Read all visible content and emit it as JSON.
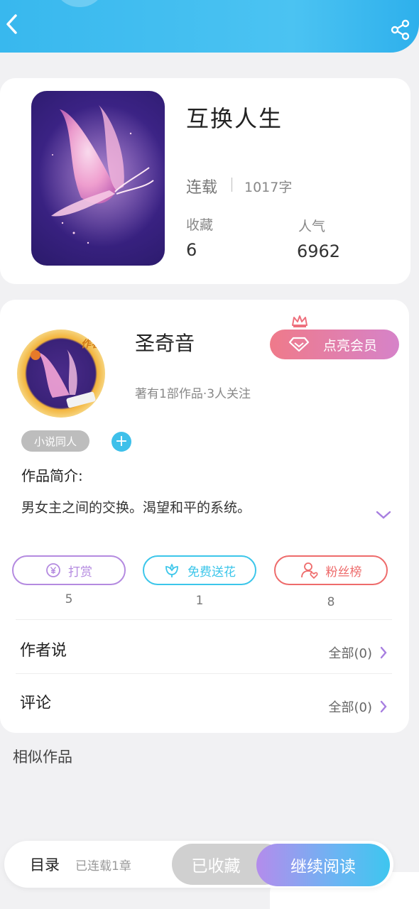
{
  "book": {
    "title": "互换人生",
    "status": "连载",
    "word_count": "1017字",
    "stats": [
      {
        "label": "收藏",
        "value": "6"
      },
      {
        "label": "人气",
        "value": "6962"
      }
    ]
  },
  "author": {
    "avatar_tag": "作者",
    "name": "圣奇音",
    "meta": "著有1部作品·3人关注",
    "vip_label": "点亮会员",
    "tag": "小说同人",
    "add_tag": "+"
  },
  "intro": {
    "title": "作品简介:",
    "text": "男女主之间的交换。渴望和平的系统。"
  },
  "actions": [
    {
      "label": "打赏",
      "count": "5",
      "color": "#b48ae0",
      "icon": "yen-coin-icon"
    },
    {
      "label": "免费送花",
      "count": "1",
      "color": "#3cc6ea",
      "icon": "flower-icon"
    },
    {
      "label": "粉丝榜",
      "count": "8",
      "color": "#ee6b6b",
      "icon": "fan-user-icon"
    }
  ],
  "rows": [
    {
      "title": "作者说",
      "right": "全部(0)"
    },
    {
      "title": "评论",
      "right": "全部(0)"
    }
  ],
  "similar_title": "相似作品",
  "bottom_bar": {
    "toc_label": "目录",
    "toc_sub": "已连载1章",
    "collected_label": "已收藏",
    "read_label": "继续阅读"
  },
  "colors": {
    "header": "#3fbdf0",
    "accent_purple": "#a77ee0",
    "accent_cyan": "#3ec6ef",
    "vip_pink": "#ef7a8a"
  }
}
